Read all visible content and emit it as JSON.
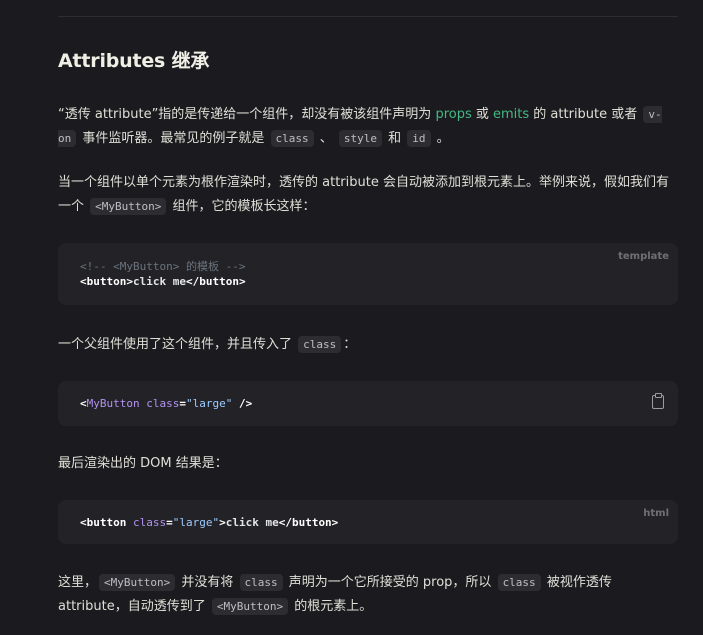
{
  "heading": "Attributes 继承",
  "p1": {
    "t1": "“透传 attribute”指的是传递给一个组件，却没有被该组件声明为 ",
    "props": "props",
    "t2": " 或 ",
    "emits": "emits",
    "t3": " 的 attribute 或者 ",
    "von": "v-on",
    "t4": " 事件监听器。最常见的例子就是 ",
    "class": "class",
    "t5": " 、 ",
    "style": "style",
    "t6": " 和 ",
    "id": "id",
    "t7": " 。"
  },
  "p2": {
    "t1": "当一个组件以单个元素为根作渲染时，透传的 attribute 会自动被添加到根元素上。举例来说，假如我们有一个 ",
    "comp": "<MyButton>",
    "t2": " 组件，它的模板长这样："
  },
  "code1": {
    "lang": "template",
    "line1": "<!-- <MyButton> 的模板 -->",
    "line2_open": "<button>",
    "line2_text": "click me",
    "line2_close": "</button>"
  },
  "p3": {
    "t1": "一个父组件使用了这个组件，并且传入了 ",
    "class": "class",
    "t2": "："
  },
  "code2": {
    "open": "<",
    "comp": "MyButton",
    "sp": " ",
    "attr": "class",
    "eq": "=",
    "str": "\"large\"",
    "close": " />"
  },
  "p4": {
    "text": "最后渲染出的 DOM 结果是："
  },
  "code3": {
    "lang": "html",
    "open": "<button ",
    "attr": "class",
    "eq": "=",
    "str": "\"large\"",
    "gt": ">",
    "text": "click me",
    "close": "</button>"
  },
  "p5": {
    "t1": "这里，",
    "comp1": "<MyButton>",
    "t2": " 并没有将 ",
    "class1": "class",
    "t3": " 声明为一个它所接受的 prop，所以 ",
    "class2": "class",
    "t4": " 被视作透传 attribute，自动透传到了 ",
    "comp2": "<MyButton>",
    "t5": " 的根元素上。"
  }
}
